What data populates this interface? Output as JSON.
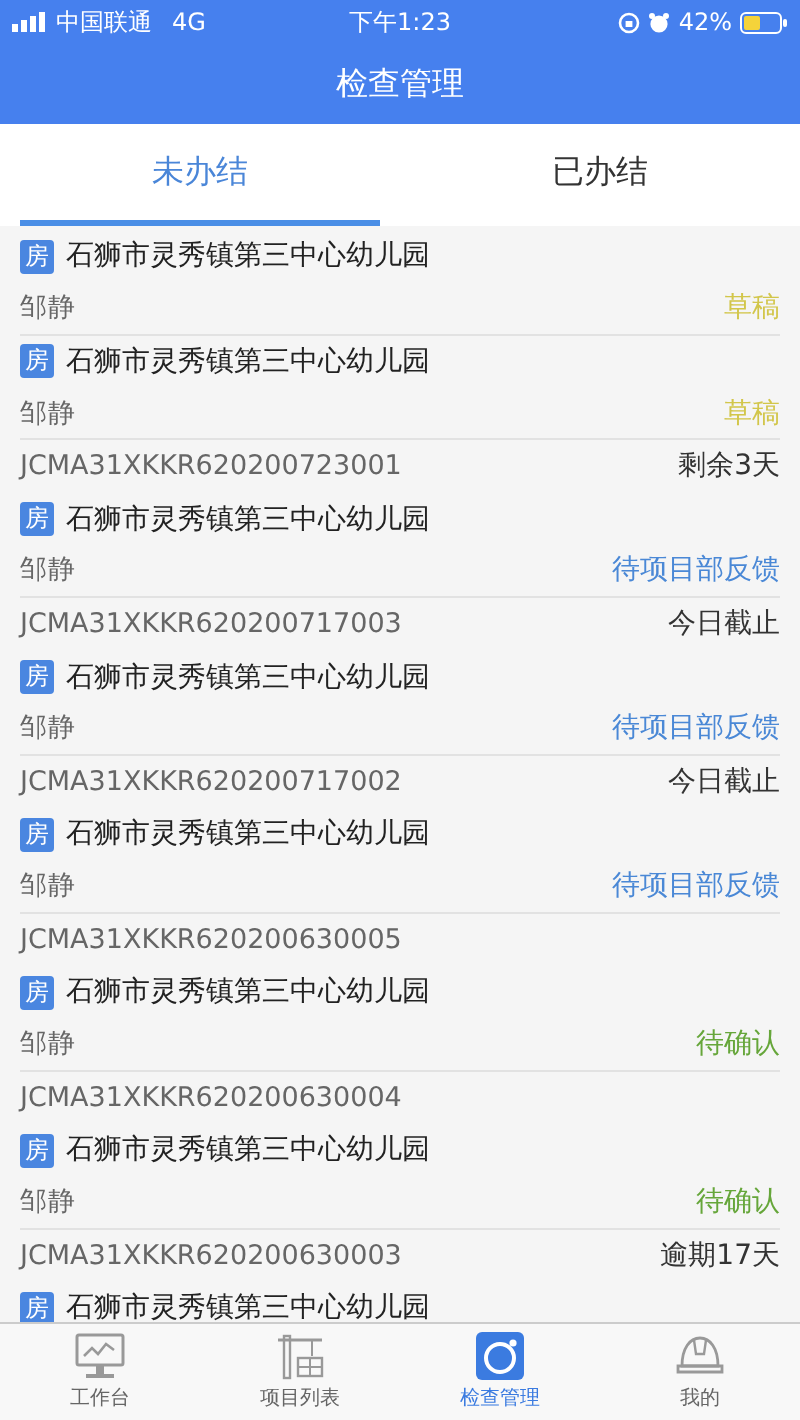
{
  "status_bar": {
    "carrier": "中国联通",
    "network": "4G",
    "time": "下午1:23",
    "battery": "42%"
  },
  "header": {
    "title": "检查管理"
  },
  "tabs": [
    {
      "label": "未办结",
      "selected": true
    },
    {
      "label": "已办结",
      "selected": false
    }
  ],
  "records": [
    {
      "tag": "房",
      "title": "石狮市灵秀镇第三中心幼儿园",
      "person": "邹静",
      "status": "草稿",
      "color": "#d2c64a"
    },
    {
      "tag": "房",
      "title": "石狮市灵秀镇第三中心幼儿园",
      "person": "邹静",
      "status": "草稿",
      "color": "#d2c64a"
    },
    {
      "code": "JCMA31XKKR620200723001",
      "deadline": "剩余3天",
      "tag": "房",
      "title": "石狮市灵秀镇第三中心幼儿园",
      "person": "邹静",
      "status": "待项目部反馈",
      "color": "#4a88d6"
    },
    {
      "code": "JCMA31XKKR620200717003",
      "deadline": "今日截止",
      "tag": "房",
      "title": "石狮市灵秀镇第三中心幼儿园",
      "person": "邹静",
      "status": "待项目部反馈",
      "color": "#4a88d6"
    },
    {
      "code": "JCMA31XKKR620200717002",
      "deadline": "今日截止",
      "tag": "房",
      "title": "石狮市灵秀镇第三中心幼儿园",
      "person": "邹静",
      "status": "待项目部反馈",
      "color": "#4a88d6"
    },
    {
      "code": "JCMA31XKKR620200630005",
      "tag": "房",
      "title": "石狮市灵秀镇第三中心幼儿园",
      "person": "邹静",
      "status": "待确认",
      "color": "#66a63a"
    },
    {
      "code": "JCMA31XKKR620200630004",
      "tag": "房",
      "title": "石狮市灵秀镇第三中心幼儿园",
      "person": "邹静",
      "status": "待确认",
      "color": "#66a63a"
    },
    {
      "code": "JCMA31XKKR620200630003",
      "deadline": "逾期17天",
      "tag": "房",
      "title": "石狮市灵秀镇第三中心幼儿园"
    }
  ],
  "nav": [
    {
      "label": "工作台",
      "kind": "monitor",
      "selected": false
    },
    {
      "label": "项目列表",
      "kind": "crane",
      "selected": false
    },
    {
      "label": "检查管理",
      "kind": "camera",
      "selected": true
    },
    {
      "label": "我的",
      "kind": "helmet",
      "selected": false
    }
  ]
}
